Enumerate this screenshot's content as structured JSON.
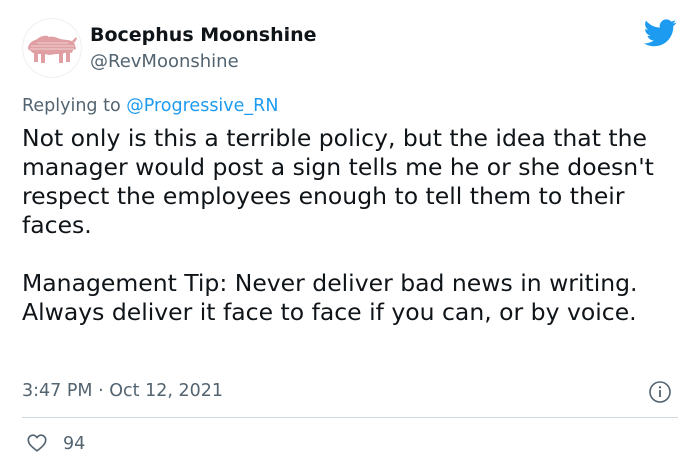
{
  "tweet": {
    "display_name": "Bocephus Moonshine",
    "handle": "@RevMoonshine",
    "replying_prefix": "Replying to",
    "replying_to": "@Progressive_RN",
    "body_paragraph_1": "Not only is this a terrible policy, but the idea that the manager would post a sign tells me he or she doesn't respect the employees enough to tell them to their faces.",
    "body_paragraph_2": "Management Tip: Never deliver bad news in writing. Always deliver it face to face if you can, or by voice.",
    "time": "3:47 PM",
    "separator": "·",
    "date": "Oct 12, 2021",
    "likes": "94"
  },
  "icons": {
    "logo": "twitter-bird-icon",
    "info": "info-icon",
    "like": "heart-icon",
    "avatar": "buffalo-avatar"
  },
  "colors": {
    "brand_blue": "#1d9bf0",
    "text_primary": "#0f1419",
    "text_secondary": "#536471",
    "divider": "#cfd9de",
    "avatar_buffalo": "#e0a0a3"
  }
}
